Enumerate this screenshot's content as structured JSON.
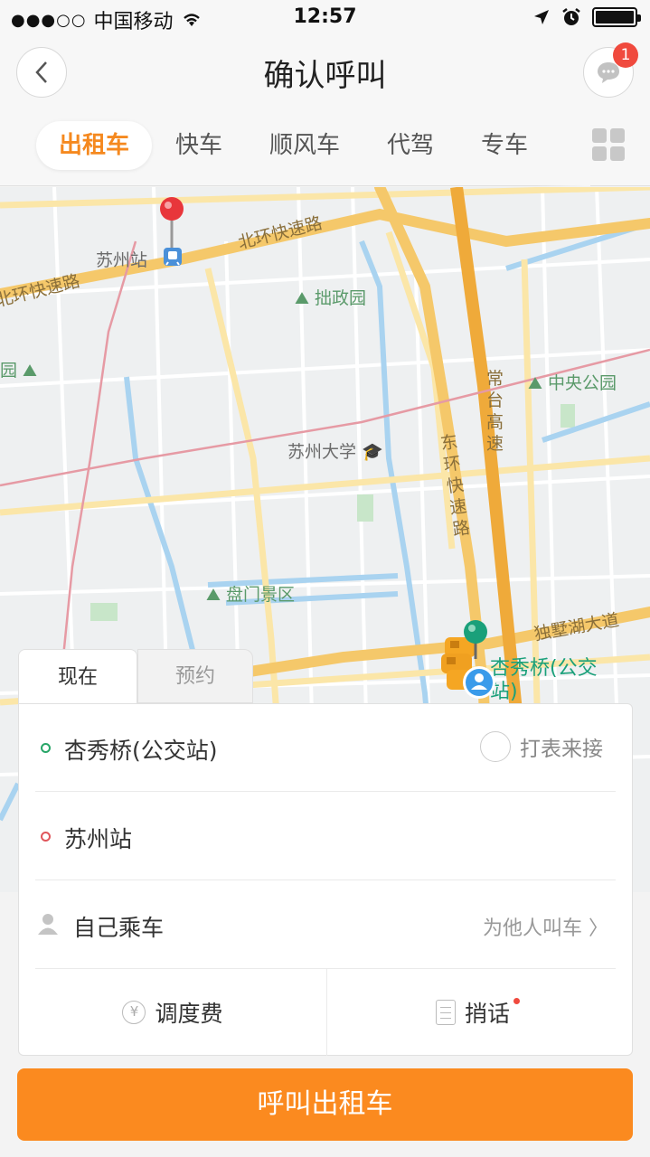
{
  "status_bar": {
    "signal": "●●●○○",
    "carrier": "中国移动",
    "time": "12:57"
  },
  "nav": {
    "title": "确认呼叫",
    "message_badge": "1"
  },
  "category_tabs": [
    {
      "label": "出租车",
      "active": true
    },
    {
      "label": "快车",
      "active": false
    },
    {
      "label": "顺风车",
      "active": false
    },
    {
      "label": "代驾",
      "active": false
    },
    {
      "label": "专车",
      "active": false
    }
  ],
  "map": {
    "labels": {
      "suzhou_station": "苏州站",
      "north_ring_1": "北环快速路",
      "north_ring_2": "北环快速路",
      "zhuozheng_garden": "拙政园",
      "garden_left": "园",
      "central_park": "中央公园",
      "changtai_highway": "常台高速",
      "suzhou_university": "苏州大学",
      "east_ring": "东环快速路",
      "panmen": "盘门景区",
      "dushu_lake": "独墅湖大道",
      "pickup_point": "杏秀桥(公交站)"
    },
    "colors": {
      "major_road": "#f5c86a",
      "minor_road": "#fbe6a8",
      "water": "#a9d3f0",
      "park": "#c8e6c9",
      "background": "#eef0f1"
    }
  },
  "booking": {
    "tab_now": "现在",
    "tab_reserve": "预约",
    "origin": "杏秀桥(公交站)",
    "meter_label": "打表来接",
    "destination": "苏州站",
    "passenger": "自己乘车",
    "for_other": "为他人叫车 〉",
    "dispatch_fee": "调度费",
    "message": "捎话",
    "origin_color": "#27a567",
    "destination_color": "#e0565b"
  },
  "call_button": "呼叫出租车",
  "accent_color": "#fb8a1f"
}
